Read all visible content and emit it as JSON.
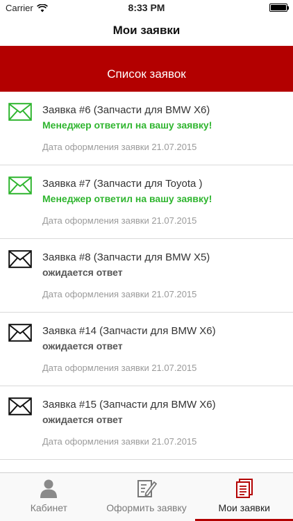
{
  "status_bar": {
    "carrier": "Carrier",
    "time": "8:33 PM"
  },
  "nav": {
    "title": "Мои заявки"
  },
  "header": {
    "title": "Список заявок"
  },
  "colors": {
    "accent": "#b30000",
    "answered": "#2fb52f",
    "pending": "#555555"
  },
  "requests": [
    {
      "title": "Заявка #6 (Запчасти для BMW X6)",
      "status": "Менеджер ответил на вашу заявку!",
      "answered": true,
      "date": "Дата оформления заявки 21.07.2015",
      "icon": "envelope-icon"
    },
    {
      "title": "Заявка #7 (Запчасти для Toyota )",
      "status": "Менеджер ответил на вашу заявку!",
      "answered": true,
      "date": "Дата оформления заявки 21.07.2015",
      "icon": "envelope-icon"
    },
    {
      "title": "Заявка #8 (Запчасти для BMW X5)",
      "status": "ожидается ответ",
      "answered": false,
      "date": "Дата оформления заявки 21.07.2015",
      "icon": "envelope-icon"
    },
    {
      "title": "Заявка #14 (Запчасти для BMW X6)",
      "status": "ожидается ответ",
      "answered": false,
      "date": "Дата оформления заявки 21.07.2015",
      "icon": "envelope-icon"
    },
    {
      "title": "Заявка #15 (Запчасти для BMW X6)",
      "status": "ожидается ответ",
      "answered": false,
      "date": "Дата оформления заявки 21.07.2015",
      "icon": "envelope-icon"
    }
  ],
  "tabs": [
    {
      "label": "Кабинет",
      "icon": "user-icon",
      "active": false
    },
    {
      "label": "Оформить заявку",
      "icon": "edit-form-icon",
      "active": false
    },
    {
      "label": "Мои заявки",
      "icon": "documents-icon",
      "active": true
    }
  ]
}
